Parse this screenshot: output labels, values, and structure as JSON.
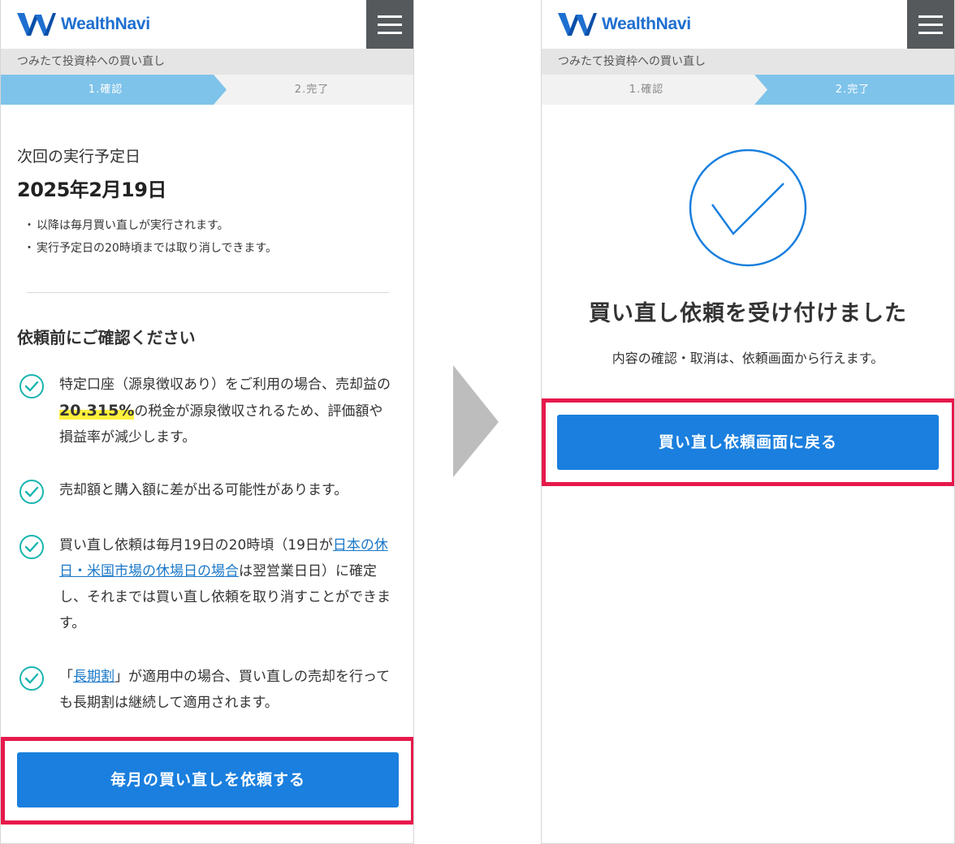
{
  "brand": {
    "name": "WealthNavi",
    "logo_color": "#1e6fd0"
  },
  "colors": {
    "step_active": "#7ec3ea",
    "step_inactive": "#f2f2f2",
    "button": "#1a7fde",
    "highlight_frame": "#e6194b",
    "check_icon": "#19b5b0",
    "success_circle": "#1a7fde"
  },
  "left_screen": {
    "subtitle": "つみたて投資枠への買い直し",
    "steps": [
      {
        "label": "1.確認",
        "active": true
      },
      {
        "label": "2.完了",
        "active": false
      }
    ],
    "next_date_label": "次回の実行予定日",
    "next_date": "2025年2月19日",
    "notes": [
      "以降は毎月買い直しが実行されます。",
      "実行予定日の20時頃までは取り消しできます。"
    ],
    "confirm_title": "依頼前にご確認ください",
    "confirm_items": {
      "item1": {
        "before": "特定口座（源泉徴収あり）をご利用の場合、売却益の",
        "highlight": "20.315%",
        "after": "の税金が源泉徴収されるため、評価額や損益率が減少します。"
      },
      "item2": {
        "text": "売却額と購入額に差が出る可能性があります。"
      },
      "item3": {
        "before": "買い直し依頼は毎月19日の20時頃（19日が",
        "link": "日本の休日・米国市場の休場日の場合",
        "after": "は翌営業日日）に確定し、それまでは買い直し依頼を取り消すことができます。"
      },
      "item4": {
        "before": "「",
        "link": "長期割",
        "after": "」が適用中の場合、買い直しの売却を行っても長期割は継続して適用されます。"
      }
    },
    "submit_button": "毎月の買い直しを依頼する"
  },
  "right_screen": {
    "subtitle": "つみたて投資枠への買い直し",
    "steps": [
      {
        "label": "1.確認",
        "active": false
      },
      {
        "label": "2.完了",
        "active": true
      }
    ],
    "done_title": "買い直し依頼を受け付けました",
    "done_subtitle": "内容の確認・取消は、依頼画面から行えます。",
    "back_button": "買い直し依頼画面に戻る"
  }
}
